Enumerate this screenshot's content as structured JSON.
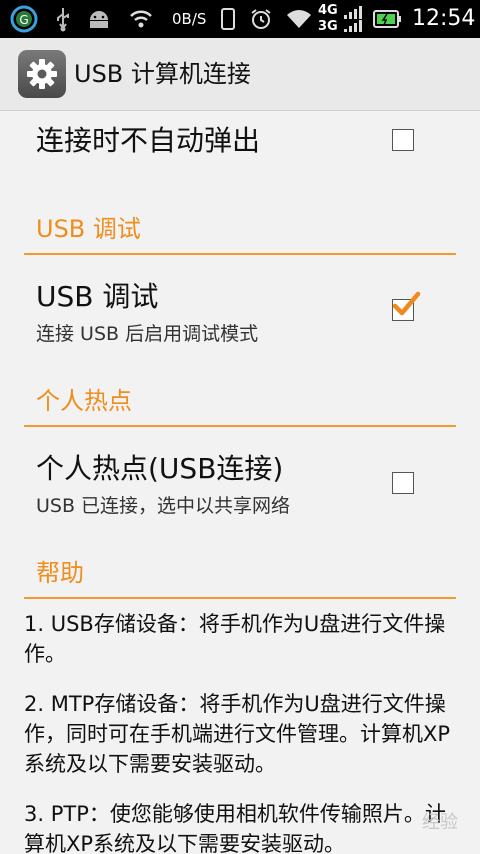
{
  "status_bar": {
    "speed": "0B/S",
    "network_top": "4G",
    "network_bottom": "3G",
    "time": "12:54",
    "icons": [
      "app-g-icon",
      "usb-icon",
      "android-debug-icon",
      "wifi-hotspot-icon",
      "phone-icon",
      "alarm-icon",
      "wifi-icon",
      "signal-icon",
      "battery-icon"
    ]
  },
  "action_bar": {
    "title": "USB 计算机连接",
    "icon": "settings-gear-icon"
  },
  "preferences": {
    "no_auto_popup": {
      "title": "连接时不自动弹出",
      "checked": false
    },
    "usb_debug_category": "USB 调试",
    "usb_debug": {
      "title": "USB 调试",
      "summary": "连接 USB 后启用调试模式",
      "checked": true
    },
    "hotspot_category": "个人热点",
    "hotspot": {
      "title": "个人热点(USB连接)",
      "summary": "USB 已连接，选中以共享网络",
      "checked": false
    },
    "help_category": "帮助"
  },
  "help": {
    "item1": "1. USB存储设备：将手机作为U盘进行文件操作。",
    "item2": "2. MTP存储设备：将手机作为U盘进行文件操作，同时可在手机端进行文件管理。计算机XP系统及以下需要安装驱动。",
    "item3": "3. PTP：使您能够使用相机软件传输照片。计算机XP系统及以下需要安装驱动。"
  },
  "colors": {
    "accent": "#ef8d1d",
    "status_bar": "#000000",
    "background": "#f2f2f2"
  },
  "watermark": "经验"
}
